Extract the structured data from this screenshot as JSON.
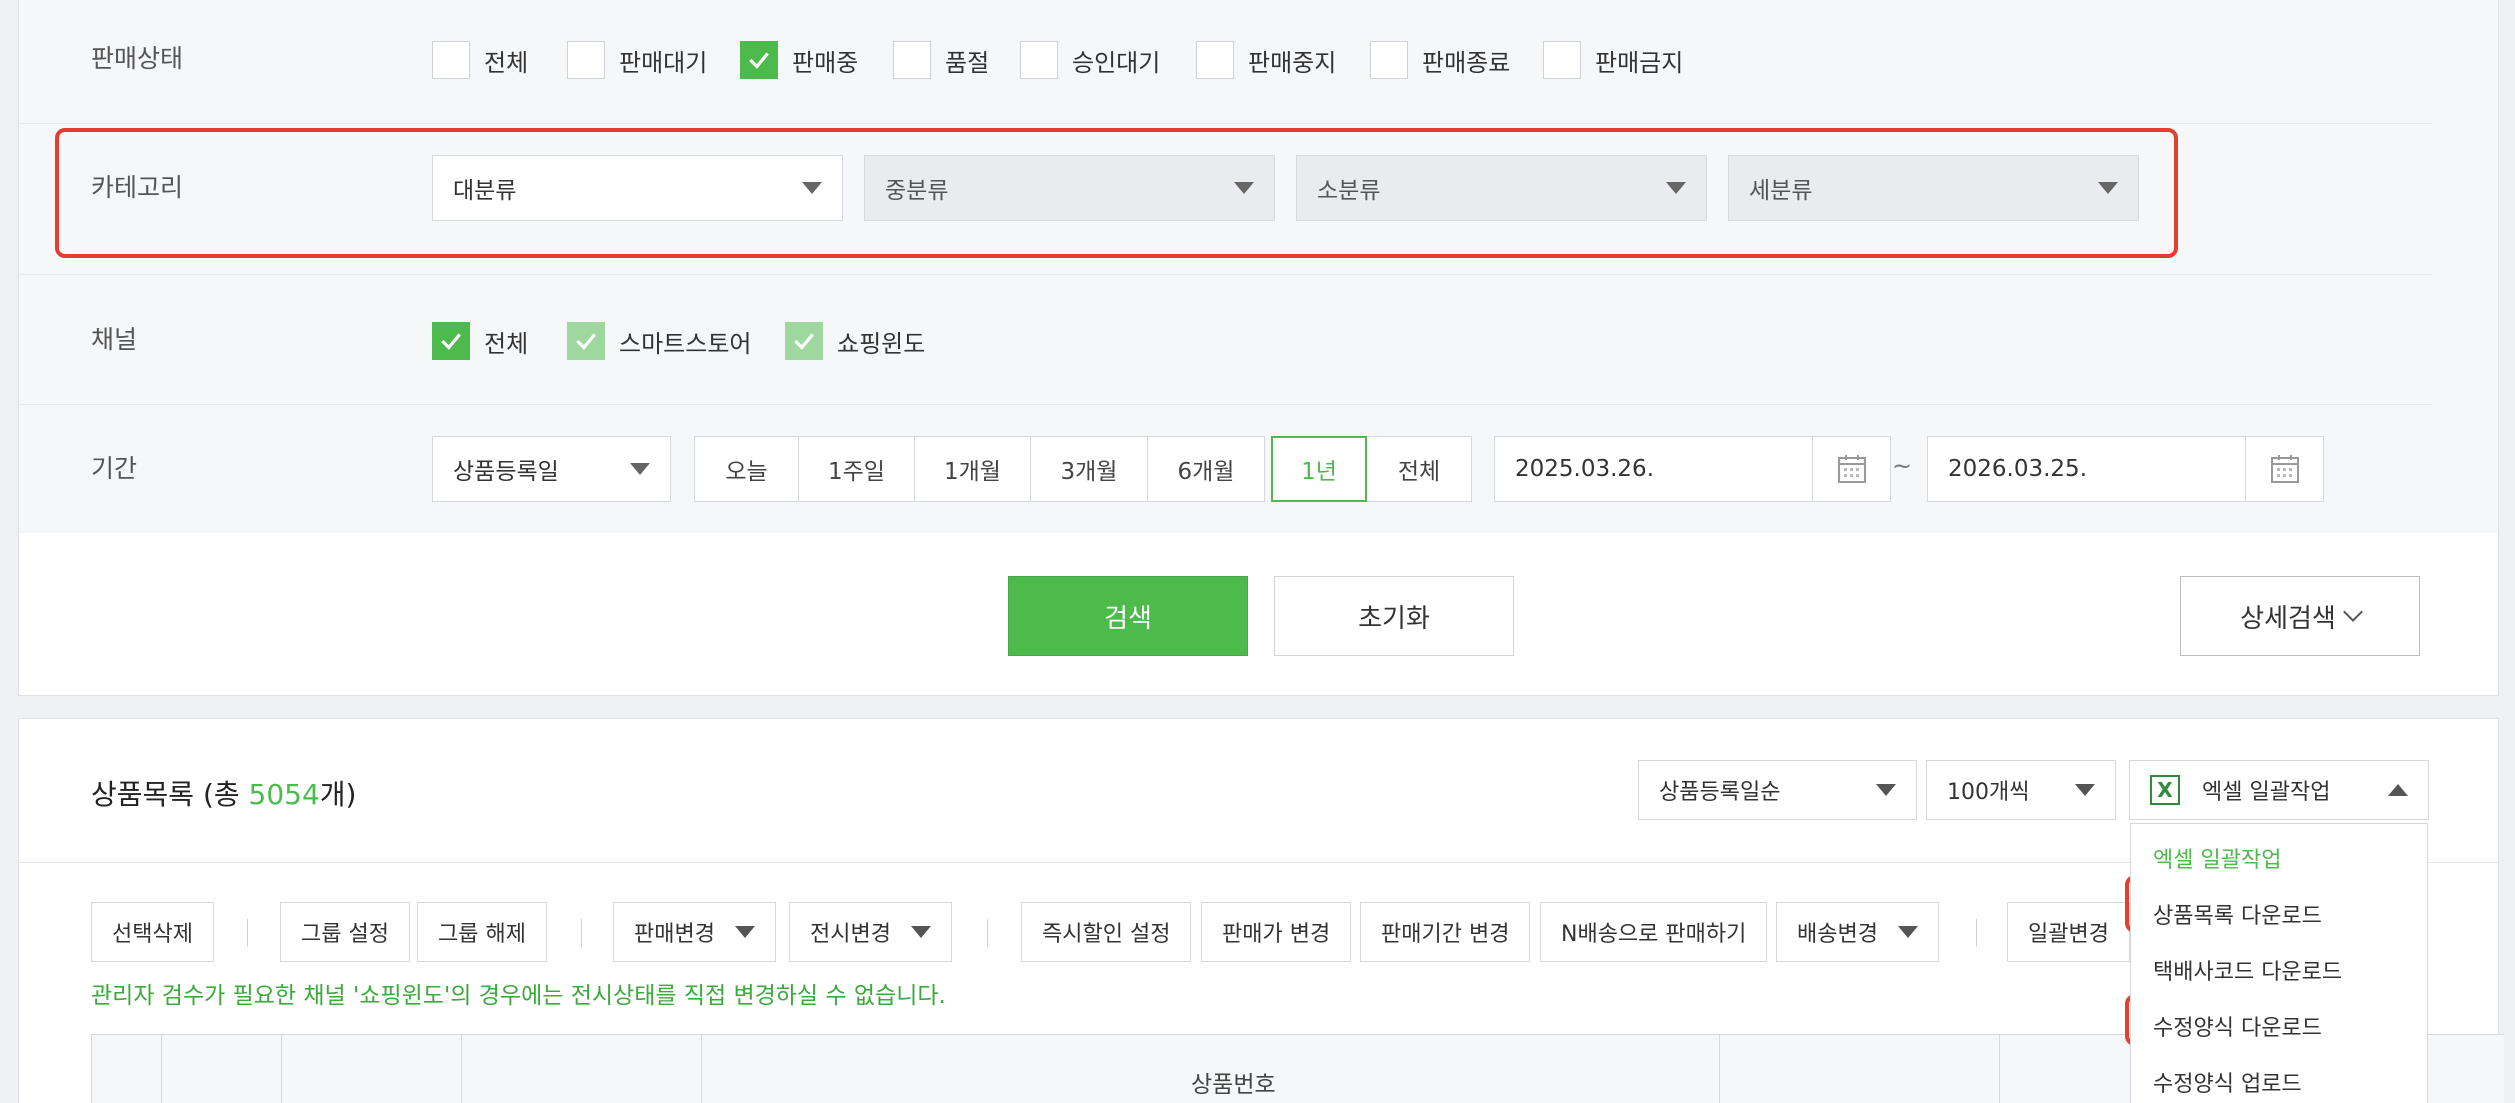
{
  "filters": {
    "sale_status": {
      "label": "판매상태",
      "options": [
        {
          "label": "전체",
          "checked": false
        },
        {
          "label": "판매대기",
          "checked": false
        },
        {
          "label": "판매중",
          "checked": true
        },
        {
          "label": "품절",
          "checked": false
        },
        {
          "label": "승인대기",
          "checked": false
        },
        {
          "label": "판매중지",
          "checked": false
        },
        {
          "label": "판매종료",
          "checked": false
        },
        {
          "label": "판매금지",
          "checked": false
        }
      ]
    },
    "category": {
      "label": "카테고리",
      "selects": [
        "대분류",
        "중분류",
        "소분류",
        "세분류"
      ]
    },
    "channel": {
      "label": "채널",
      "options": [
        {
          "label": "전체",
          "checked": true
        },
        {
          "label": "스마트스토어",
          "checked": true
        },
        {
          "label": "쇼핑윈도",
          "checked": true
        }
      ]
    },
    "period": {
      "label": "기간",
      "date_type": "상품등록일",
      "ranges": [
        "오늘",
        "1주일",
        "1개월",
        "3개월",
        "6개월",
        "1년",
        "전체"
      ],
      "active_range": "1년",
      "start_date": "2025.03.26.",
      "separator": "~",
      "end_date": "2026.03.25."
    }
  },
  "actions": {
    "search": "검색",
    "reset": "초기화",
    "detail_search": "상세검색"
  },
  "product_list": {
    "title_prefix": "상품목록 (총 ",
    "count": "5054",
    "title_suffix": "개)",
    "sort": "상품등록일순",
    "page_size": "100개씩",
    "excel_menu": "엑셀 일괄작업",
    "excel_icon_glyph": "X",
    "toolbar": {
      "delete": "선택삭제",
      "group_set": "그룹 설정",
      "group_unset": "그룹 해제",
      "sale_change": "판매변경",
      "display_change": "전시변경",
      "instant_discount": "즉시할인 설정",
      "price_change": "판매가 변경",
      "period_change": "판매기간 변경",
      "n_delivery": "N배송으로 판매하기",
      "delivery_change": "배송변경",
      "bulk_change": "일괄변경"
    },
    "notice": "관리자 검수가 필요한 채널 '쇼핑윈도'의 경우에는 전시상태를 직접 변경하실 수 없습니다.",
    "table_header": "상품번호",
    "excel_dropdown": {
      "header": "엑셀 일괄작업",
      "items": [
        "상품목록 다운로드",
        "택배사코드 다운로드",
        "수정양식 다운로드",
        "수정양식 업로드"
      ]
    }
  },
  "colors": {
    "accent_green": "#4cbb4c",
    "highlight_red": "#e53e30"
  }
}
